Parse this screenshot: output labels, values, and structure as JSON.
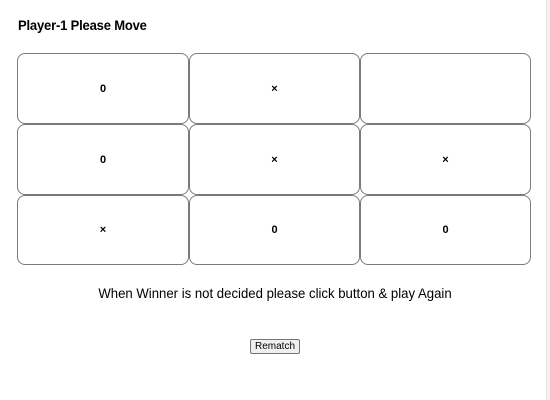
{
  "status": {
    "text": "Player-1 Please Move"
  },
  "board": {
    "cells": [
      [
        "0",
        "×",
        ""
      ],
      [
        "0",
        "×",
        "×"
      ],
      [
        "×",
        "0",
        "0"
      ]
    ]
  },
  "message": {
    "text": "When Winner is not decided please click button & play Again"
  },
  "controls": {
    "rematch_label": "Rematch"
  },
  "colors": {
    "cell_border": "#7a7a7a",
    "background": "#ffffff"
  }
}
